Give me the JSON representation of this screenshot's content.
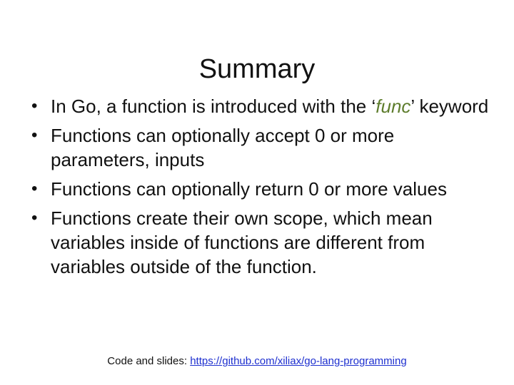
{
  "slide": {
    "title": "Summary",
    "bullets": [
      {
        "prefix": "In Go, a function is introduced with the ‘",
        "emphasis": "func",
        "suffix": "’ keyword"
      },
      {
        "text": "Functions can optionally accept 0 or more parameters, inputs"
      },
      {
        "text": "Functions can optionally return 0 or more values"
      },
      {
        "text": "Functions create their own scope, which mean variables inside of functions are different from variables outside of the function."
      }
    ],
    "bullet_symbol": "•",
    "footer": {
      "label": "Code and slides: ",
      "link_text": "https://github.com/xiliax/go-lang-programming"
    }
  },
  "colors": {
    "emphasis": "#5e7d2d",
    "link": "#1d2fcf"
  }
}
